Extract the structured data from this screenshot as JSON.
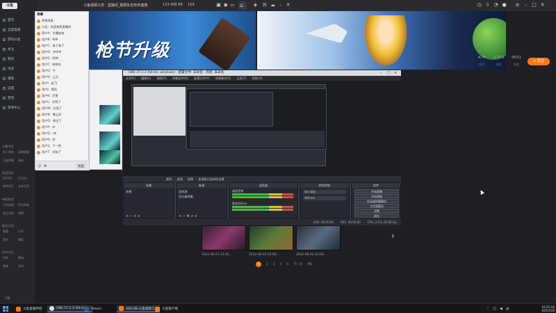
{
  "sidebar": {
    "logo": "斗鱼",
    "items": [
      {
        "label": "首页"
      },
      {
        "label": "全部直播"
      },
      {
        "label": "游戏分类"
      },
      {
        "label": "关注"
      },
      {
        "label": "我的"
      },
      {
        "label": "消息"
      },
      {
        "label": "播放"
      },
      {
        "label": "设置"
      },
      {
        "label": "游戏"
      },
      {
        "label": "游戏中心"
      }
    ],
    "sections": [
      {
        "title": "主播专区",
        "items": [
          "热门游戏",
          "英雄联盟",
          "王者荣耀",
          "原神"
        ]
      },
      {
        "title": "网游竞技",
        "items": [
          "DOTA2",
          "CS:GO",
          "绝地求生",
          "永劫无间"
        ]
      },
      {
        "title": "单机热游",
        "items": [
          "主机游戏",
          "怀旧游戏",
          "独立游戏",
          "棋牌"
        ]
      },
      {
        "title": "娱乐天地",
        "items": [
          "颜值",
          "户外",
          "音乐",
          "舞蹈"
        ]
      },
      {
        "title": "科技文化",
        "items": [
          "科技",
          "数码",
          "教育",
          "读书"
        ]
      }
    ],
    "footer": "下载"
  },
  "topbar": {
    "title": "斗鱼视频工坊 ‧ 直播间_极限反击年终盛典",
    "count": "123 408 88",
    "viewers": "159"
  },
  "banner": {
    "headline": "枪节升级"
  },
  "stats": [
    {
      "value": "474",
      "label": "关注"
    },
    {
      "value": "1,371",
      "label": "粉丝"
    },
    {
      "value": "9531",
      "label": "热度"
    }
  ],
  "follow_button": "+ 关注",
  "chat": {
    "header": "弹幕",
    "rows": [
      "系统消息",
      "公告：欢迎来到直播间",
      "用户A：主播加油",
      "用户B：666",
      "用户C：来了来了",
      "用户D：冲冲冲",
      "用户E：好帅",
      "用户F：哈哈哈",
      "用户G：牛",
      "用户H：上分",
      "用户I：起飞",
      "用户J：稳住",
      "用户K：厉害",
      "用户L：学到了",
      "用户M：太强了",
      "用户N：晚上好",
      "用户O：关注了",
      "用户P：冲",
      "用户Q：nb",
      "用户R：好",
      "用户S：下一把",
      "用户T：开始了"
    ],
    "bottom": "发送"
  },
  "obs": {
    "title": "OBS 27.2.3 (64-bit, windows) - 配置文件: 未命名 - 场景: 未命名",
    "menu": [
      "文件(F)",
      "编辑(E)",
      "视图(V)",
      "停靠部件(D)",
      "配置文件(P)",
      "场景集合(S)",
      "工具(T)",
      "帮助(H)"
    ],
    "controls": [
      "属性",
      "滤镜",
      "图像",
      "来源是已选择的设置"
    ],
    "docks": {
      "scenes": "场景",
      "sources": "来源",
      "mixer": "混音器",
      "transitions": "转场特效",
      "controls": "控件"
    },
    "scene_item": "场景",
    "sources": [
      "游戏源",
      "显示器采集"
    ],
    "mixer_tracks": [
      "桌面音频",
      "麦克风/Aux"
    ],
    "transition": "淡入淡出",
    "duration": "300 ms",
    "control_buttons": [
      "开始直播",
      "开始录制",
      "启动虚拟摄像机",
      "工作室模式",
      "设置",
      "退出"
    ],
    "status": [
      "LIVE: 00:00:00",
      "REC: 00:00:00",
      "CPU: 4.1%, 60.00 fps"
    ]
  },
  "videos": [
    {
      "caption": "2022-06-01 22:45..."
    },
    {
      "caption": "2022-06-02 02:00..."
    },
    {
      "caption": "2022-06-02 03:00..."
    }
  ],
  "pager": {
    "pages": [
      "1",
      "2",
      "3",
      "4",
      "5"
    ],
    "next": "下一页",
    "total": "共5"
  },
  "taskbar": {
    "items": [
      "斗鱼直播伴侣",
      "OBS 27.2.3 (64-bit)...",
      "Steam",
      "408 DB-斗鱼视频工...",
      "斗鱼客户端"
    ],
    "time": "16:55:44",
    "date": "2022/5/8"
  },
  "colors": {
    "accent": "#ff7a1a",
    "bg": "#1e1f24",
    "obs": "#3b3d46"
  }
}
